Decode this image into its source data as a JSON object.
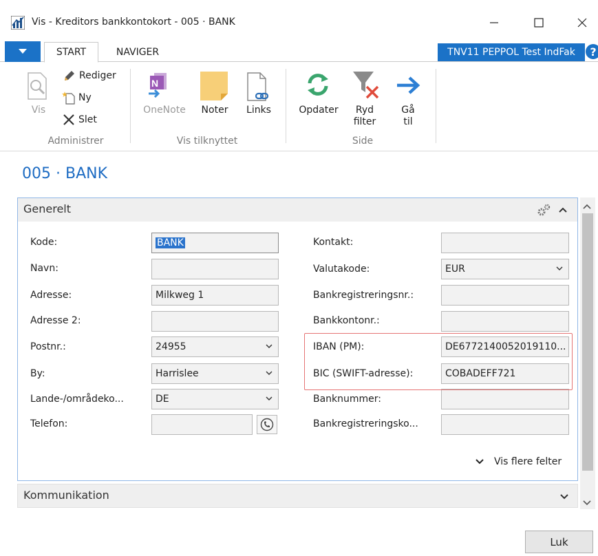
{
  "window": {
    "title": "Vis - Kreditors bankkontokort - 005 · BANK",
    "controls": {
      "minimize": "minimize",
      "maximize": "maximize",
      "close": "close"
    }
  },
  "ribbon": {
    "tabs": [
      "START",
      "NAVIGER"
    ],
    "company": "TNV11 PEPPOL Test IndFak",
    "groups": {
      "administrer": {
        "label": "Administrer",
        "vis": "Vis",
        "rediger": "Rediger",
        "ny": "Ny",
        "slet": "Slet"
      },
      "vis_tilknyttet": {
        "label": "Vis tilknyttet",
        "onenote": "OneNote",
        "noter": "Noter",
        "links": "Links"
      },
      "side": {
        "label": "Side",
        "opdater": "Opdater",
        "ryd_filter_1": "Ryd",
        "ryd_filter_2": "filter",
        "gaa_til_1": "Gå",
        "gaa_til_2": "til"
      }
    }
  },
  "page": {
    "title": "005 · BANK",
    "fasttab_general": "Generelt",
    "fasttab_communication": "Kommunikation",
    "show_more": "Vis flere felter",
    "close_button": "Luk"
  },
  "fields_left": [
    {
      "label": "Kode:",
      "value": "BANK"
    },
    {
      "label": "Navn:",
      "value": ""
    },
    {
      "label": "Adresse:",
      "value": "Milkweg 1"
    },
    {
      "label": "Adresse 2:",
      "value": ""
    },
    {
      "label": "Postnr.:",
      "value": "24955"
    },
    {
      "label": "By:",
      "value": "Harrislee"
    },
    {
      "label": "Lande-/områdeko...",
      "value": "DE"
    },
    {
      "label": "Telefon:",
      "value": ""
    }
  ],
  "fields_right": [
    {
      "label": "Kontakt:",
      "value": ""
    },
    {
      "label": "Valutakode:",
      "value": "EUR"
    },
    {
      "label": "Bankregistreringsnr.:",
      "value": ""
    },
    {
      "label": "Bankkontonr.:",
      "value": ""
    },
    {
      "label": "IBAN (PM):",
      "value": "DE6772140052019110..."
    },
    {
      "label": "BIC (SWIFT-adresse):",
      "value": "COBADEFF721"
    },
    {
      "label": "Banknummer:",
      "value": ""
    },
    {
      "label": "Bankregistreringsko...",
      "value": ""
    }
  ],
  "colors": {
    "accent": "#1b72c7",
    "title": "#1e6cc3",
    "highlight": "#e57373"
  }
}
